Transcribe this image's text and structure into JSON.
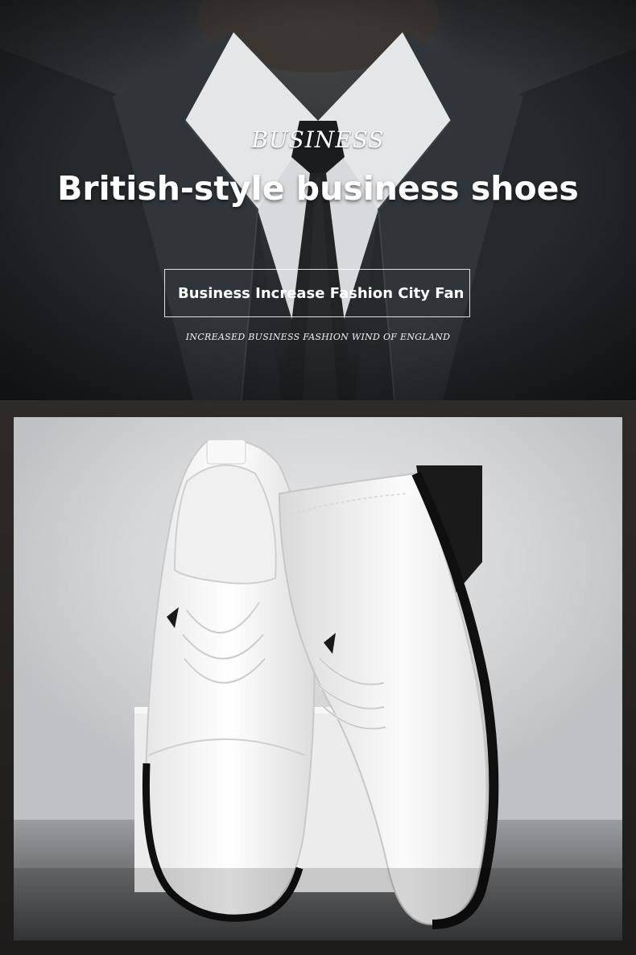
{
  "hero": {
    "eyebrow": "BUSINESS",
    "title": "British-style business shoes",
    "boxed_tagline": "Business Increase Fashion City Fan",
    "subtitle": "INCREASED BUSINESS FASHION WIND OF ENGLAND"
  },
  "photo": {
    "subject": "pair-of-white-business-shoes"
  },
  "colors": {
    "hero_text": "#ffffff",
    "suit": "#2b2f33",
    "shoe": "#f4f4f4",
    "sole": "#141414"
  }
}
